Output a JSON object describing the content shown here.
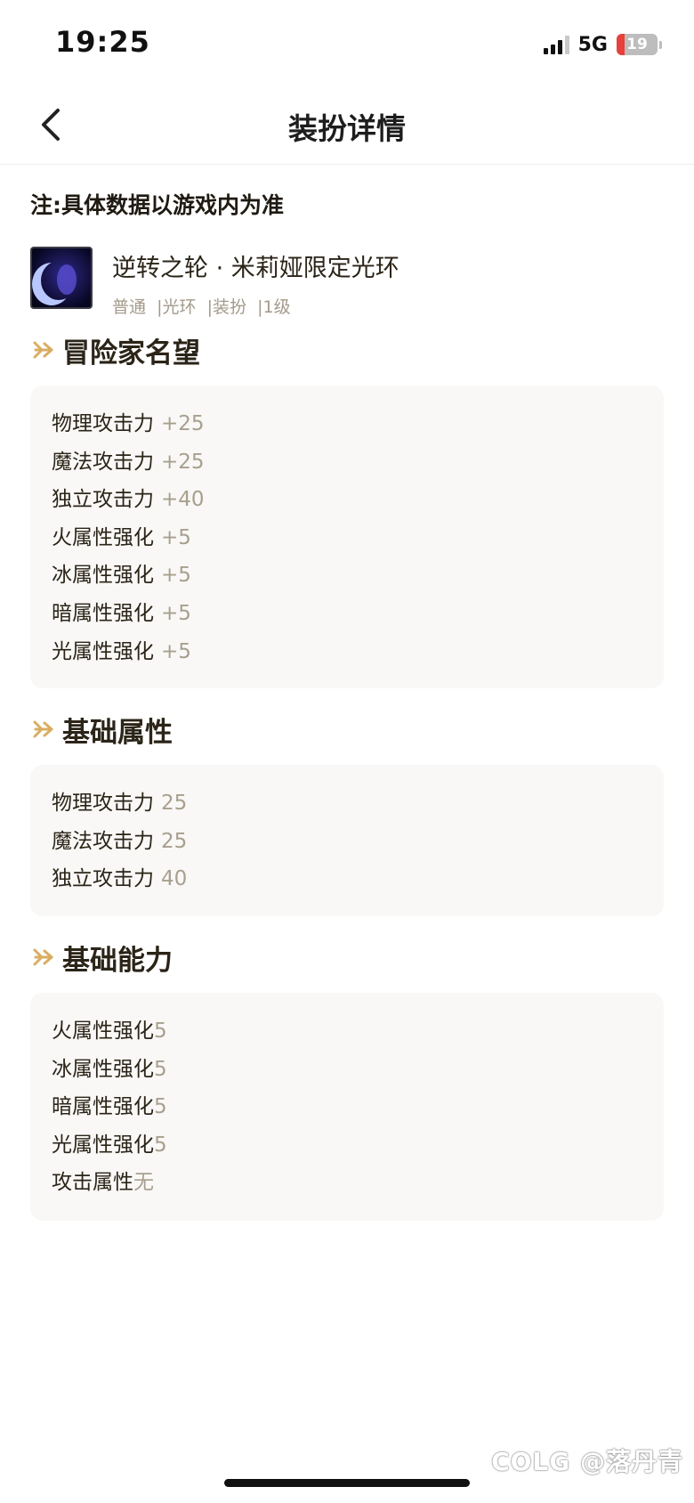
{
  "status_bar": {
    "time": "19:25",
    "network": "5G",
    "battery_level": "19",
    "battery_fraction": 0.19,
    "battery_color": "#e8403a"
  },
  "navbar": {
    "title": "装扮详情",
    "back_icon": "chevron-left-icon"
  },
  "note": "注:具体数据以游戏内为准",
  "item": {
    "name": "逆转之轮 · 米莉娅限定光环",
    "tags": [
      "普通",
      "|光环",
      "|装扮",
      "|1级"
    ],
    "icon": "aura-thumbnail"
  },
  "sections": [
    {
      "title": "冒险家名望",
      "rows": [
        {
          "label": "物理攻击力",
          "value": "+25"
        },
        {
          "label": "魔法攻击力",
          "value": "+25"
        },
        {
          "label": "独立攻击力",
          "value": "+40"
        },
        {
          "label": "火属性强化",
          "value": "+5"
        },
        {
          "label": "冰属性强化",
          "value": "+5"
        },
        {
          "label": "暗属性强化",
          "value": "+5"
        },
        {
          "label": "光属性强化",
          "value": "+5"
        }
      ]
    },
    {
      "title": "基础属性",
      "rows": [
        {
          "label": "物理攻击力",
          "value": "25"
        },
        {
          "label": "魔法攻击力",
          "value": "25"
        },
        {
          "label": "独立攻击力",
          "value": "40"
        }
      ]
    },
    {
      "title": "基础能力",
      "rows": [
        {
          "label": "火属性强化",
          "value": "5"
        },
        {
          "label": "冰属性强化",
          "value": "5"
        },
        {
          "label": "暗属性强化",
          "value": "5"
        },
        {
          "label": "光属性强化",
          "value": "5"
        },
        {
          "label": "攻击属性",
          "value": "无"
        }
      ]
    }
  ],
  "watermark": "COLG @落丹青",
  "colors": {
    "accent": "#d9ad62",
    "value_text": "#a89f8e",
    "card_bg": "#f9f8f6"
  }
}
